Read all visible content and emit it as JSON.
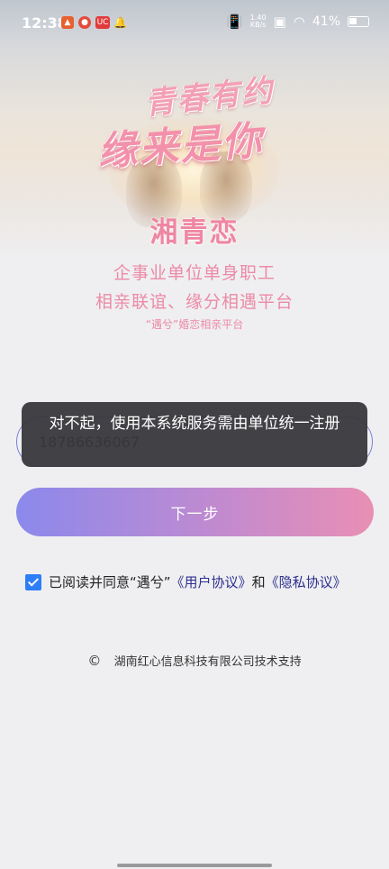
{
  "status_bar": {
    "time": "12:38",
    "notif_3": "UC",
    "net_speed_value": "1.40",
    "net_speed_unit": "KB/s",
    "battery": "41%"
  },
  "hero": {
    "slogan_line1": "青春有约",
    "slogan_line2": "缘来是你",
    "brand": "湘青恋"
  },
  "taglines": {
    "line1": "企事业单位单身职工",
    "line2": "相亲联谊、缘分相遇平台",
    "line3": "“遇兮”婚恋相亲平台"
  },
  "form": {
    "phone_value": "18786636067",
    "next_label": "下一步"
  },
  "toast": {
    "message": "对不起，使用本系统服务需由单位统一注册"
  },
  "agreement": {
    "prefix": "已阅读并同意“遇兮”",
    "user_agreement": "《用户协议》",
    "and": "和",
    "privacy_agreement": "《隐私协议》",
    "checked": true
  },
  "footer": {
    "copyright_symbol": "©",
    "text": "湖南红心信息科技有限公司技术支持"
  },
  "colors": {
    "accent_pink": "#ec8aa6",
    "button_start": "#8b89ec",
    "button_end": "#e98fb4",
    "link": "#2c2f8f",
    "checkbox": "#2d7ef7"
  }
}
